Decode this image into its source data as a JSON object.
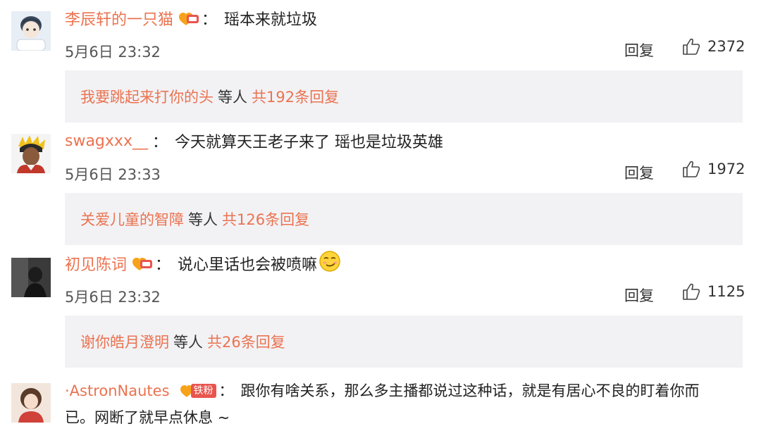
{
  "comments": [
    {
      "username": "李辰轩的一只猫",
      "text": "瑶本来就垃圾",
      "date": "5月6日 23:32",
      "reply_label": "回复",
      "likes": "2372",
      "sub_user": "我要跳起来打你的头",
      "sub_etc": "等人",
      "sub_total": "共192条回复"
    },
    {
      "username": "swagxxx__",
      "text": "今天就算天王老子来了 瑶也是垃圾英雄",
      "date": "5月6日 23:33",
      "reply_label": "回复",
      "likes": "1972",
      "sub_user": "关爱儿童的智障",
      "sub_etc": "等人",
      "sub_total": "共126条回复"
    },
    {
      "username": "初见陈词",
      "text": "说心里话也会被喷嘛",
      "date": "5月6日 23:32",
      "reply_label": "回复",
      "likes": "1125",
      "sub_user": "谢你皓月澄明",
      "sub_etc": "等人",
      "sub_total": "共26条回复"
    },
    {
      "username": "·AstronNautes",
      "badge_label": "铁粉",
      "text_line1": "跟你有啥关系，那么多主播都说过这种话，就是有居心不良的盯着你而",
      "text_line2": "已。网断了就早点休息 ~"
    }
  ],
  "colors": {
    "accent": "#eb7350",
    "subbox_bg": "#f2f2f5"
  },
  "icons": [
    "fan-badge-icon",
    "thumbs-up-icon",
    "smirk-emoji-icon"
  ]
}
